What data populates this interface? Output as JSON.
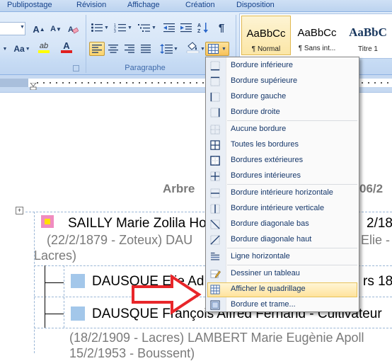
{
  "ribbon": {
    "tabs": [
      "Publipostage",
      "Révision",
      "Affichage",
      "Création",
      "Disposition"
    ],
    "group_label": "Paragraphe",
    "buttons": {
      "bullets": "bullets-icon",
      "numbering": "numbering-icon",
      "multilevel": "multilevel-list-icon",
      "decrease_indent": "decrease-indent-icon",
      "increase_indent": "increase-indent-icon",
      "sort": "sort-icon",
      "pilcrow": "pilcrow-icon",
      "align_left": "align-left-icon",
      "align_center": "align-center-icon",
      "align_right": "align-right-icon",
      "justify": "justify-icon",
      "line_spacing": "line-spacing-icon",
      "shading": "shading-icon",
      "borders": "borders-icon"
    },
    "font_buttons": {
      "grow": "A",
      "shrink": "A",
      "change_case": "Aa",
      "highlight_label": "ab",
      "font_color_label": "A"
    },
    "styles": [
      {
        "sample": "AaBbCc",
        "name": "¶ Normal"
      },
      {
        "sample": "AaBbCc",
        "name": "¶ Sans int..."
      },
      {
        "sample": "AaBbC",
        "name": "Titre 1"
      }
    ]
  },
  "menu": {
    "items": [
      {
        "label": "Bordure inférieure",
        "icon": "border-bottom-icon"
      },
      {
        "label": "Bordure supérieure",
        "icon": "border-top-icon"
      },
      {
        "label": "Bordure gauche",
        "icon": "border-left-icon"
      },
      {
        "label": "Bordure droite",
        "icon": "border-right-icon"
      },
      {
        "label": "Aucune bordure",
        "icon": "no-border-icon"
      },
      {
        "label": "Toutes les bordures",
        "icon": "all-borders-icon"
      },
      {
        "label": "Bordures extérieures",
        "icon": "outside-borders-icon"
      },
      {
        "label": "Bordures intérieures",
        "icon": "inside-borders-icon"
      },
      {
        "label": "Bordure intérieure horizontale",
        "icon": "inside-horizontal-border-icon"
      },
      {
        "label": "Bordure intérieure verticale",
        "icon": "inside-vertical-border-icon"
      },
      {
        "label": "Bordure diagonale bas",
        "icon": "diagonal-down-border-icon"
      },
      {
        "label": "Bordure diagonale haut",
        "icon": "diagonal-up-border-icon"
      },
      {
        "label": "Ligne horizontale",
        "icon": "horizontal-line-icon"
      },
      {
        "label": "Dessiner un tableau",
        "icon": "draw-table-icon"
      },
      {
        "label": "Afficher le quadrillage",
        "icon": "view-gridlines-icon"
      },
      {
        "label": "Bordure et trame...",
        "icon": "borders-and-shading-icon"
      }
    ],
    "highlighted": "Afficher le quadrillage"
  },
  "document": {
    "heading_partial": "Arbre",
    "heading_right": "06/2",
    "person1_name": "SAILLY Marie Zolila Ho",
    "person1_right": "2/18",
    "person1_detail": "(22/2/1879 - Zoteux) DAU",
    "person1_detail_right": "Elie -",
    "person1_place": "Lacres)",
    "child1": "DAUSQUE Elie Ad",
    "child1_right": "rs 18",
    "child2": "DAUSQUE François Alfred Fernand - Cultivateur",
    "child2_detail": "(18/2/1909 - Lacres) LAMBERT Marie Eugènie Apoll",
    "child2_detail2": "15/2/1953 - Boussent)"
  },
  "colors": {
    "person1_marker": "#f08cc0",
    "person1_marker_inner": "#ffe000",
    "child_marker": "#a3c7ea",
    "arrow": "#e8262a"
  }
}
